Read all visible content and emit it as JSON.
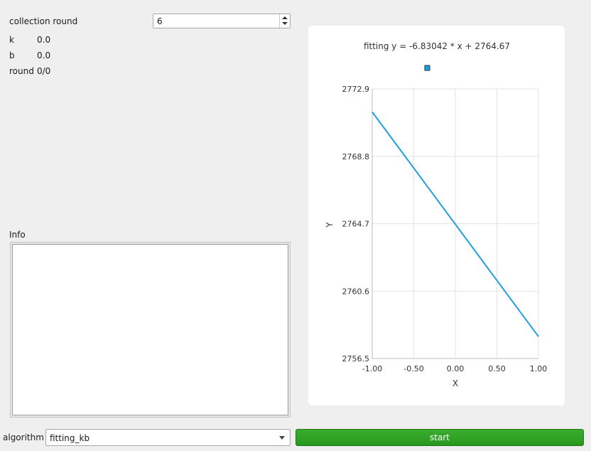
{
  "params": {
    "collection_round_label": "collection round",
    "collection_round_value": "6",
    "k_label": "k",
    "k_value": "0.0",
    "b_label": "b",
    "b_value": "0.0",
    "round_label": "round",
    "round_value": "0/0"
  },
  "info": {
    "label": "Info"
  },
  "bottom": {
    "algorithm_label": "algorithm",
    "algorithm_value": "fitting_kb",
    "start_label": "start"
  },
  "colors": {
    "line": "#209fdf",
    "start_button": "#2fa326",
    "legend_marker": "#209fdf"
  },
  "chart_data": {
    "type": "line",
    "title": "fitting y = -6.83042 * x + 2764.67",
    "xlabel": "X",
    "ylabel": "Y",
    "xlim": [
      -1.0,
      1.0
    ],
    "ylim": [
      2756.5,
      2772.9
    ],
    "x_ticks": [
      "-1.00",
      "-0.50",
      "0.00",
      "0.50",
      "1.00"
    ],
    "y_ticks": [
      "2756.5",
      "2760.6",
      "2764.7",
      "2768.8",
      "2772.9"
    ],
    "grid": true,
    "legend": "top-center",
    "series": [
      {
        "x": [
          -1.0,
          1.0
        ],
        "y": [
          2771.50042,
          2757.83958
        ]
      }
    ]
  }
}
